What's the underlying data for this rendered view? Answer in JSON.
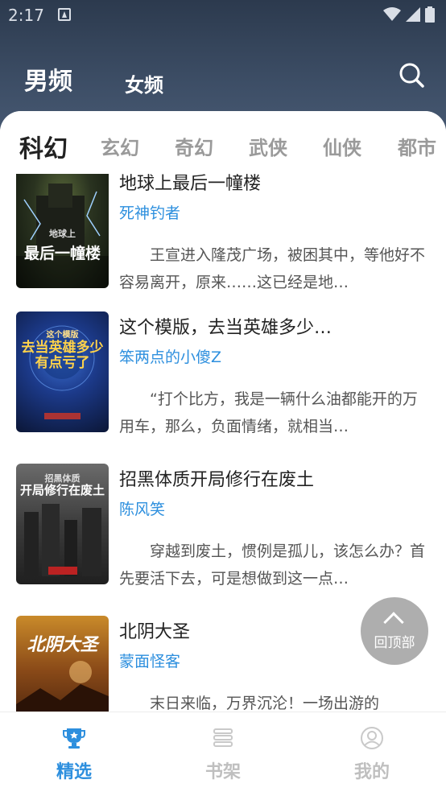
{
  "status_bar": {
    "time": "2:17"
  },
  "header": {
    "tabs": [
      {
        "label": "男频",
        "active": true
      },
      {
        "label": "女频",
        "active": false
      }
    ],
    "search_icon": "search-icon"
  },
  "categories": [
    {
      "label": "科幻",
      "active": true
    },
    {
      "label": "玄幻",
      "active": false
    },
    {
      "label": "奇幻",
      "active": false
    },
    {
      "label": "武侠",
      "active": false
    },
    {
      "label": "仙侠",
      "active": false
    },
    {
      "label": "都市",
      "active": false
    }
  ],
  "books": [
    {
      "title": "地球上最后一幢楼",
      "author": "死神钓者",
      "description": "王宣进入隆茂广场，被困其中，等他好不容易离开，原来……这已经是地…",
      "cover_text": "最后一幢楼",
      "cover_top_text": "地球上"
    },
    {
      "title": "这个模版，去当英雄多少…",
      "author": "笨两点的小傻Z",
      "description": "“打个比方，我是一辆什么油都能开的万用车，那么，负面情绪，就相当…",
      "cover_text": "去当英雄多少有点亏了",
      "cover_top_text": "这个模版"
    },
    {
      "title": "招黑体质开局修行在废土",
      "author": "陈风笑",
      "description": "穿越到废土，惯例是孤儿，该怎么办？首先要活下去，可是想做到这一点…",
      "cover_text": "开局修行在废土",
      "cover_top_text": "招黑体质"
    },
    {
      "title": "北阴大圣",
      "author": "蒙面怪客",
      "description": "末日来临，万界沉沦！一场出游的",
      "cover_text": "北阴大圣",
      "cover_top_text": ""
    }
  ],
  "back_to_top": {
    "label": "回顶部"
  },
  "tab_bar": [
    {
      "label": "精选",
      "icon": "trophy-icon",
      "active": true
    },
    {
      "label": "书架",
      "icon": "bookshelf-icon",
      "active": false
    },
    {
      "label": "我的",
      "icon": "profile-icon",
      "active": false
    }
  ],
  "colors": {
    "accent": "#2d8fde",
    "header_bg": "#34455c",
    "inactive": "#bfbfbf"
  }
}
